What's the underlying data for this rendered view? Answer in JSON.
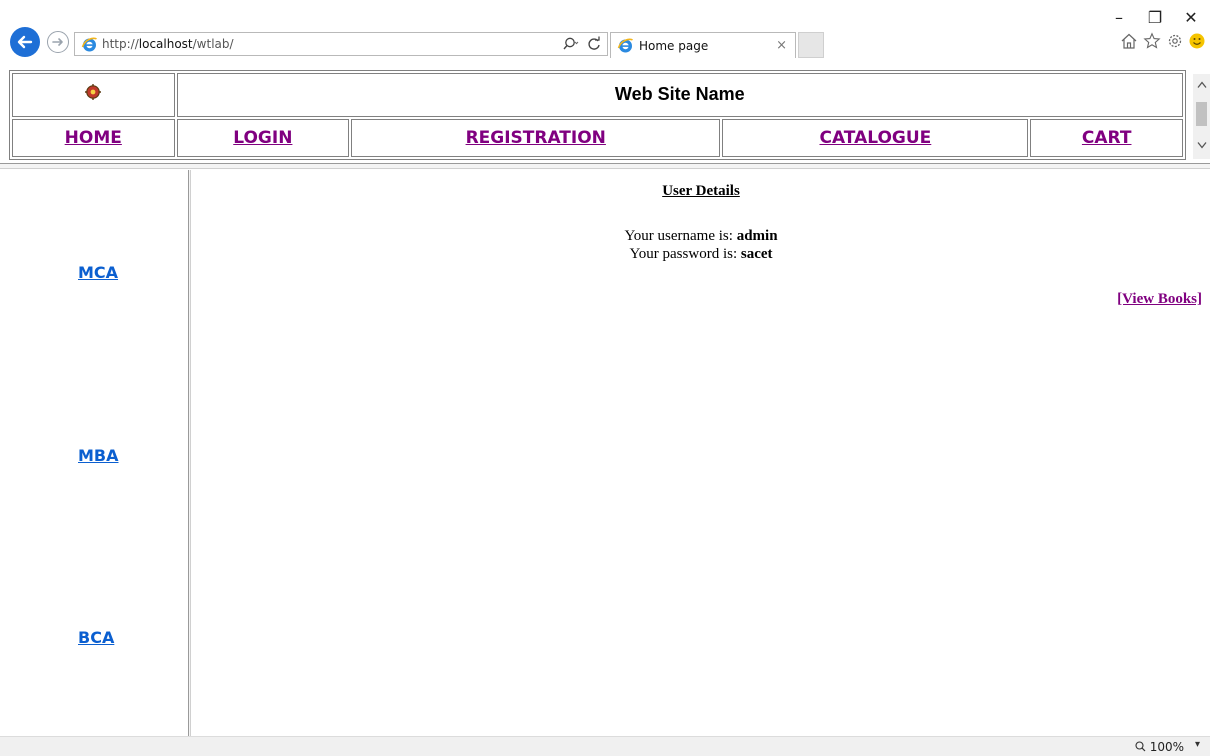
{
  "browser": {
    "url_prefix": "http://",
    "url_host": "localhost",
    "url_path": "/wtlab/",
    "tab_title": "Home page",
    "tab_close": "×",
    "window_minimize": "–",
    "window_restore": "❐",
    "window_close": "✕",
    "accent": "#1e6fd6"
  },
  "header": {
    "site_name": "Web Site Name"
  },
  "nav": {
    "items": [
      {
        "label": "HOME"
      },
      {
        "label": "LOGIN"
      },
      {
        "label": "REGISTRATION"
      },
      {
        "label": "CATALOGUE"
      },
      {
        "label": "CART"
      }
    ],
    "link_color": "#800080"
  },
  "sidebar": {
    "items": [
      {
        "label": "MCA"
      },
      {
        "label": "MBA"
      },
      {
        "label": "BCA"
      }
    ],
    "link_color": "#0b5fd0"
  },
  "main": {
    "title": "User Details",
    "username_label": "Your username is:",
    "username_value": "admin",
    "password_label": "Your password is:",
    "password_value": "sacet",
    "view_books_link": "[View Books]"
  },
  "statusbar": {
    "zoom": "100%",
    "zoom_dropdown": "▾"
  }
}
